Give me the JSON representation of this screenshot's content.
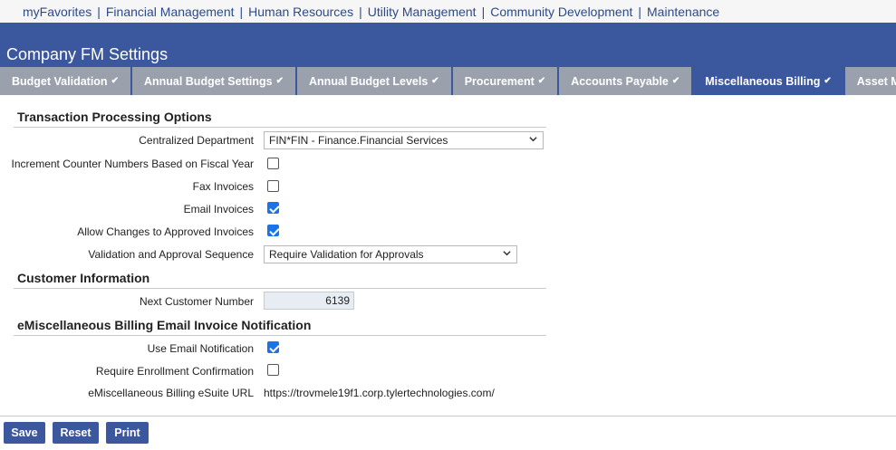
{
  "topnav": {
    "items": [
      "myFavorites",
      "Financial Management",
      "Human Resources",
      "Utility Management",
      "Community Development",
      "Maintenance"
    ]
  },
  "header": {
    "title": "Company FM Settings"
  },
  "tabs": [
    {
      "label": "Budget Validation",
      "active": false
    },
    {
      "label": "Annual Budget Settings",
      "active": false
    },
    {
      "label": "Annual Budget Levels",
      "active": false
    },
    {
      "label": "Procurement",
      "active": false
    },
    {
      "label": "Accounts Payable",
      "active": false
    },
    {
      "label": "Miscellaneous Billing",
      "active": true
    },
    {
      "label": "Asset Managem",
      "active": false
    }
  ],
  "sections": {
    "transaction": {
      "title": "Transaction Processing Options",
      "centralized_department_label": "Centralized Department",
      "centralized_department_value": "FIN*FIN - Finance.Financial Services",
      "increment_counter_label": "Increment Counter Numbers Based on Fiscal Year",
      "increment_counter_checked": false,
      "fax_invoices_label": "Fax Invoices",
      "fax_invoices_checked": false,
      "email_invoices_label": "Email Invoices",
      "email_invoices_checked": true,
      "allow_changes_label": "Allow Changes to Approved Invoices",
      "allow_changes_checked": true,
      "validation_sequence_label": "Validation and Approval Sequence",
      "validation_sequence_value": "Require Validation for Approvals"
    },
    "customer": {
      "title": "Customer Information",
      "next_customer_label": "Next Customer Number",
      "next_customer_value": "6139"
    },
    "notification": {
      "title": "eMiscellaneous Billing Email Invoice Notification",
      "use_email_label": "Use Email Notification",
      "use_email_checked": true,
      "require_enrollment_label": "Require Enrollment Confirmation",
      "require_enrollment_checked": false,
      "esuite_url_label": "eMiscellaneous Billing eSuite URL",
      "esuite_url_value": "https://trovmele19f1.corp.tylertechnologies.com/"
    }
  },
  "buttons": {
    "save": "Save",
    "reset": "Reset",
    "print": "Print"
  },
  "colors": {
    "header_bg": "#3b579d",
    "tab_inactive": "#9aa1ad",
    "link": "#2c4a8c",
    "checkbox_checked": "#1a73e8"
  },
  "icons": {
    "tab_check": "checkmark-icon",
    "select_caret": "chevron-down-icon"
  }
}
